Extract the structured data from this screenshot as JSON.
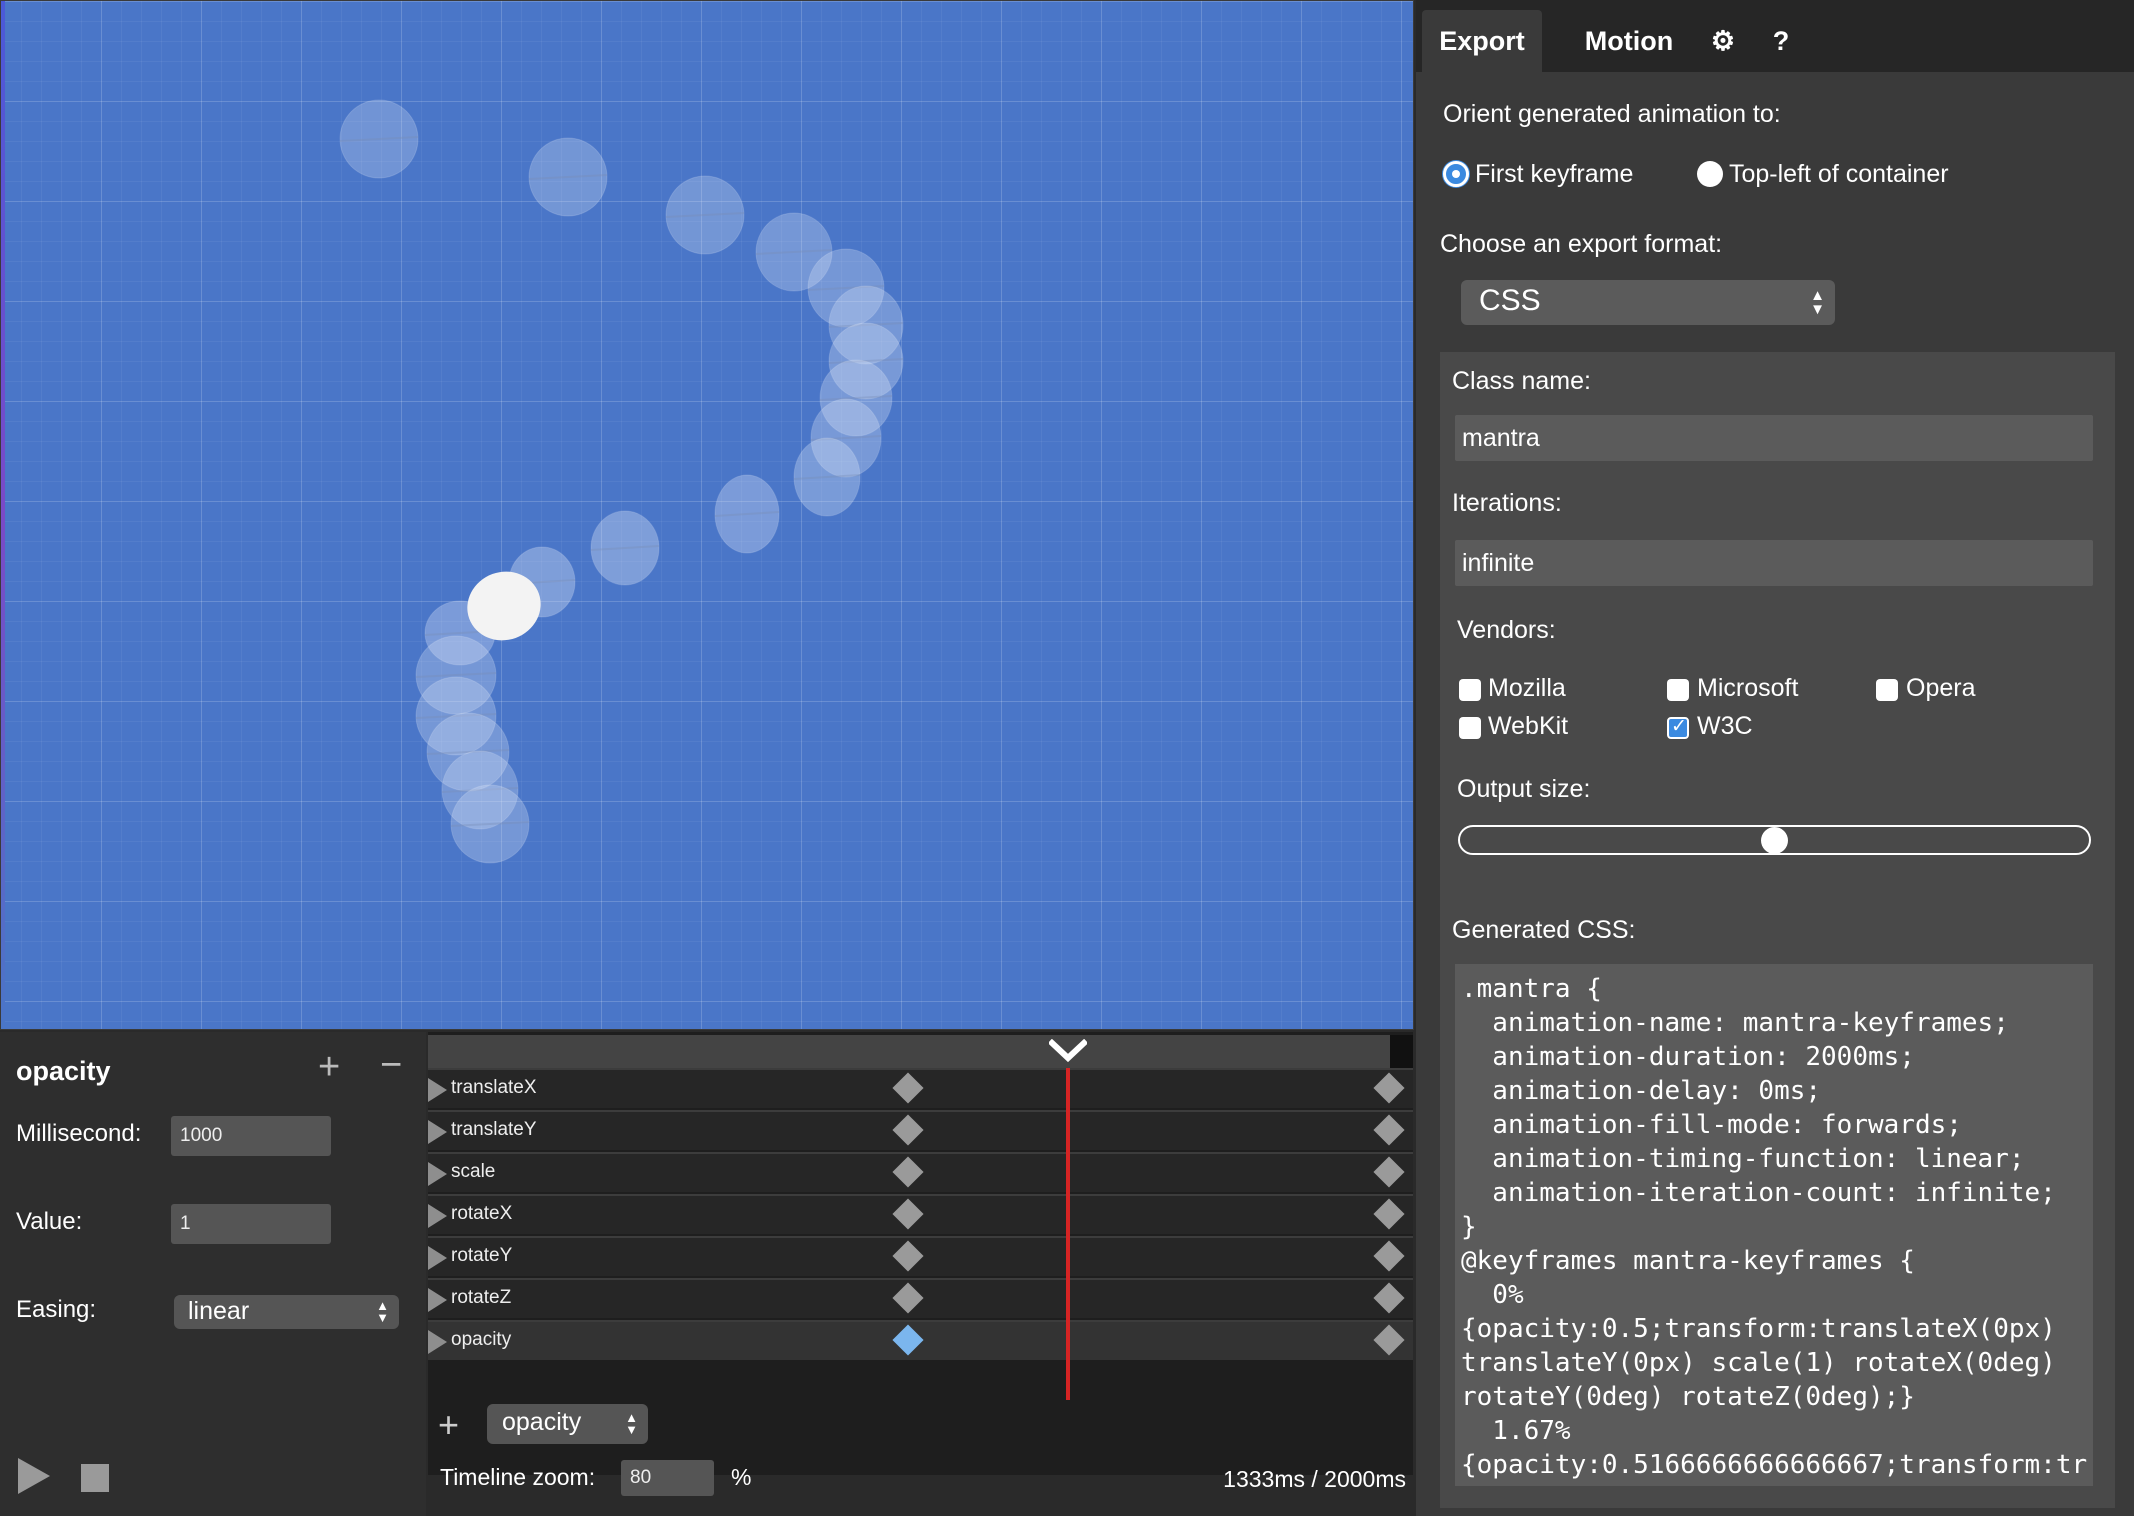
{
  "editor": {
    "property": "opacity",
    "add_property_icon": "plus-icon",
    "remove_property_icon": "minus-icon",
    "millisecond_label": "Millisecond:",
    "millisecond_value": "1000",
    "value_label": "Value:",
    "value_value": "1",
    "easing_label": "Easing:",
    "easing_value": "linear"
  },
  "timeline": {
    "tracks": [
      {
        "label": "translateX"
      },
      {
        "label": "translateY"
      },
      {
        "label": "scale"
      },
      {
        "label": "rotateX"
      },
      {
        "label": "rotateY"
      },
      {
        "label": "rotateZ"
      },
      {
        "label": "opacity",
        "active": true
      }
    ],
    "keyframes_ms": [
      1000,
      2000
    ],
    "selected_keyframe_ms": 1000,
    "playhead_ms": 1333,
    "duration_ms": 2000,
    "add_track_icon": "plus-icon",
    "add_track_select": "opacity",
    "zoom_label": "Timeline zoom:",
    "zoom_value": "80",
    "zoom_unit": "%",
    "time_readout": "1333ms / 2000ms",
    "playhead_handle_icon": "chevron-down-icon"
  },
  "controls": {
    "play_icon": "play-icon",
    "stop_icon": "stop-icon"
  },
  "panel": {
    "tabs": [
      "Export",
      "Motion"
    ],
    "active_tab": "Export",
    "settings_icon": "gear-icon",
    "help_label": "?",
    "orient_label": "Orient generated animation to:",
    "orient_options": [
      "First keyframe",
      "Top-left of container"
    ],
    "orient_selected": "First keyframe",
    "format_label": "Choose an export format:",
    "format_value": "CSS",
    "class_label": "Class name:",
    "class_value": "mantra",
    "iterations_label": "Iterations:",
    "iterations_value": "infinite",
    "vendors_label": "Vendors:",
    "vendors": [
      {
        "name": "Mozilla",
        "checked": false
      },
      {
        "name": "Microsoft",
        "checked": false
      },
      {
        "name": "Opera",
        "checked": false
      },
      {
        "name": "WebKit",
        "checked": false
      },
      {
        "name": "W3C",
        "checked": true
      }
    ],
    "output_size_label": "Output size:",
    "output_size_level": 0.5,
    "generated_label": "Generated CSS:",
    "generated_code": [
      ".mantra {",
      "  animation-name: mantra-keyframes;",
      "  animation-duration: 2000ms;",
      "  animation-delay: 0ms;",
      "  animation-fill-mode: forwards;",
      "  animation-timing-function: linear;",
      "  animation-iteration-count: infinite;",
      "}",
      "@keyframes mantra-keyframes {",
      "  0%",
      "{opacity:0.5;transform:translateX(0px)",
      "translateY(0px) scale(1) rotateX(0deg)",
      "rotateY(0deg) rotateZ(0deg);}",
      "  1.67%",
      "{opacity:0.5166666666666667;transform:tr"
    ]
  },
  "colors": {
    "stage": "#4a76c8",
    "playhead": "#d62424",
    "selected_keyframe": "#7bb6ee",
    "accent": "#3b8ae0"
  }
}
